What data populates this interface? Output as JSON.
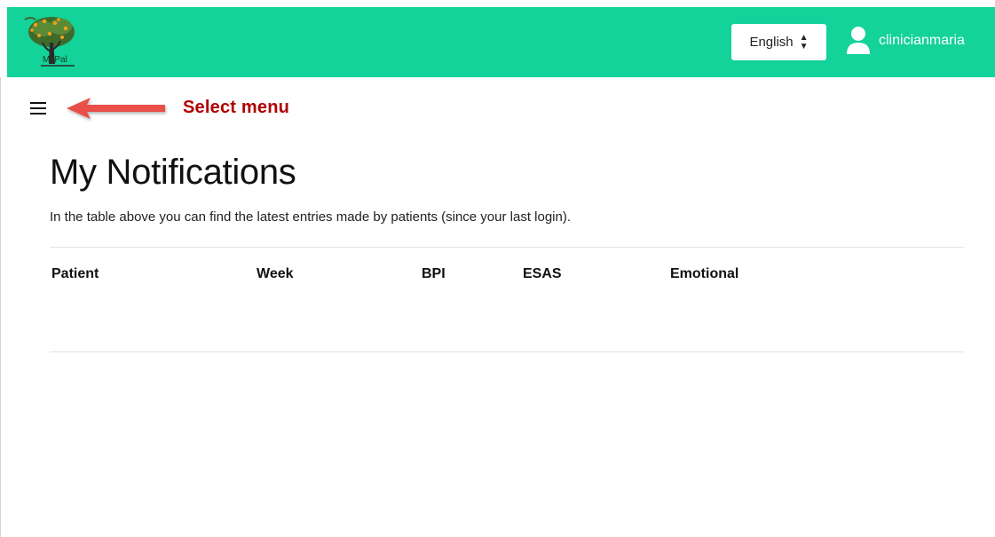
{
  "header": {
    "logo_text": "MyPal",
    "language": {
      "selected": "English"
    },
    "user": {
      "username": "clinicianmaria"
    },
    "colors": {
      "bar": "#13d29a"
    }
  },
  "menu": {
    "annotation": "Select menu",
    "annotation_color": "#b00000",
    "arrow_color": "#e8504a"
  },
  "main": {
    "title": "My Notifications",
    "subtitle": "In the table above you can find the latest entries made by patients (since your last login).",
    "table": {
      "columns": [
        "Patient",
        "Week",
        "BPI",
        "ESAS",
        "Emotional"
      ],
      "rows": []
    }
  }
}
